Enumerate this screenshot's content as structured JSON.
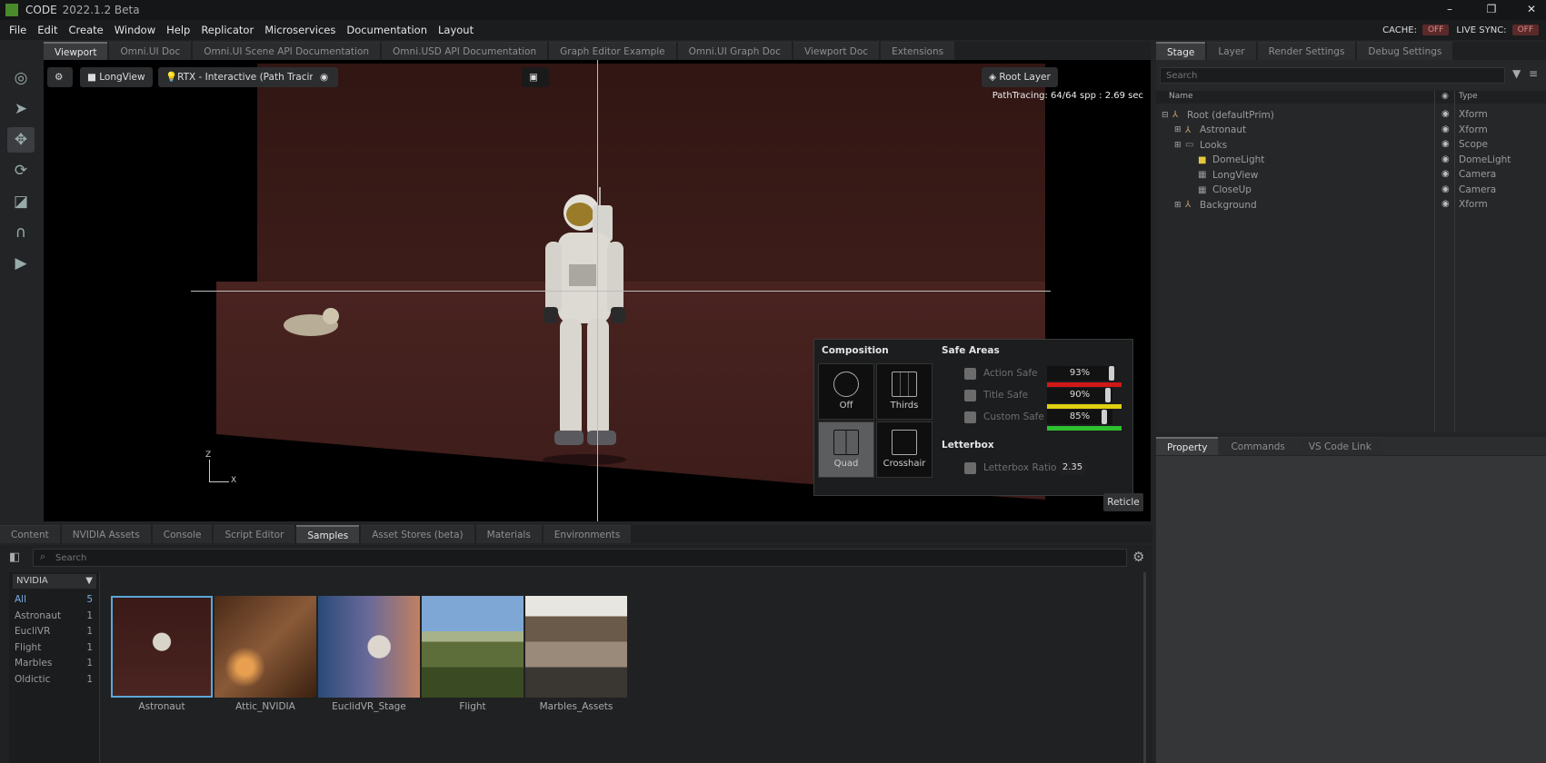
{
  "app": {
    "name": "CODE",
    "version": "2022.1.2 Beta"
  },
  "menu": [
    "File",
    "Edit",
    "Create",
    "Window",
    "Help",
    "Replicator",
    "Microservices",
    "Documentation",
    "Layout"
  ],
  "status": {
    "cache_label": "CACHE:",
    "cache_value": "OFF",
    "live_sync_label": "LIVE SYNC:",
    "live_sync_value": "OFF"
  },
  "viewport_tabs": [
    "Viewport",
    "Omni.UI Doc",
    "Omni.UI Scene API Documentation",
    "Omni.USD API Documentation",
    "Graph Editor Example",
    "Omni.UI Graph Doc",
    "Viewport Doc",
    "Extensions"
  ],
  "viewport": {
    "camera": "LongView",
    "renderer": "RTX - Interactive (Path Tracing)",
    "layer": "Root Layer",
    "stats": "PathTracing: 64/64 spp : 2.69 sec",
    "axis_z": "Z",
    "axis_x": "X",
    "reticle": "Reticle"
  },
  "composition": {
    "title": "Composition",
    "buttons": [
      "Off",
      "Thirds",
      "Quad",
      "Crosshair"
    ],
    "selected": "Quad",
    "safe_areas_title": "Safe Areas",
    "safe_areas": [
      {
        "label": "Action Safe",
        "value": "93%",
        "color": "#d01818"
      },
      {
        "label": "Title Safe",
        "value": "90%",
        "color": "#e0d010"
      },
      {
        "label": "Custom Safe",
        "value": "85%",
        "color": "#2ec02e"
      }
    ],
    "letterbox_title": "Letterbox",
    "letterbox_label": "Letterbox Ratio",
    "letterbox_value": "2.35"
  },
  "stage_tabs": [
    "Stage",
    "Layer",
    "Render Settings",
    "Debug Settings"
  ],
  "stage": {
    "search_placeholder": "Search",
    "col_name": "Name",
    "col_type": "Type",
    "rows": [
      {
        "name": "Root (defaultPrim)",
        "type": "Xform",
        "indent": 0,
        "expand": "⊟",
        "icon": "xform"
      },
      {
        "name": "Astronaut",
        "type": "Xform",
        "indent": 1,
        "expand": "⊞",
        "icon": "xform"
      },
      {
        "name": "Looks",
        "type": "Scope",
        "indent": 1,
        "expand": "⊞",
        "icon": "folder"
      },
      {
        "name": "DomeLight",
        "type": "DomeLight",
        "indent": 2,
        "expand": "",
        "icon": "light"
      },
      {
        "name": "LongView",
        "type": "Camera",
        "indent": 2,
        "expand": "",
        "icon": "camera"
      },
      {
        "name": "CloseUp",
        "type": "Camera",
        "indent": 2,
        "expand": "",
        "icon": "camera"
      },
      {
        "name": "Background",
        "type": "Xform",
        "indent": 1,
        "expand": "⊞",
        "icon": "xform"
      }
    ]
  },
  "property_tabs": [
    "Property",
    "Commands",
    "VS Code Link"
  ],
  "content_tabs": [
    "Content",
    "NVIDIA Assets",
    "Console",
    "Script Editor",
    "Samples",
    "Asset Stores (beta)",
    "Materials",
    "Environments"
  ],
  "content": {
    "search_placeholder": "Search",
    "source": "NVIDIA",
    "categories": [
      {
        "name": "All",
        "count": "5"
      },
      {
        "name": "Astronaut",
        "count": "1"
      },
      {
        "name": "EucliVR",
        "count": "1"
      },
      {
        "name": "Flight",
        "count": "1"
      },
      {
        "name": "Marbles",
        "count": "1"
      },
      {
        "name": "Oldictic",
        "count": "1"
      }
    ],
    "items": [
      "Astronaut",
      "Attic_NVIDIA",
      "EuclidVR_Stage",
      "Flight",
      "Marbles_Assets"
    ]
  }
}
